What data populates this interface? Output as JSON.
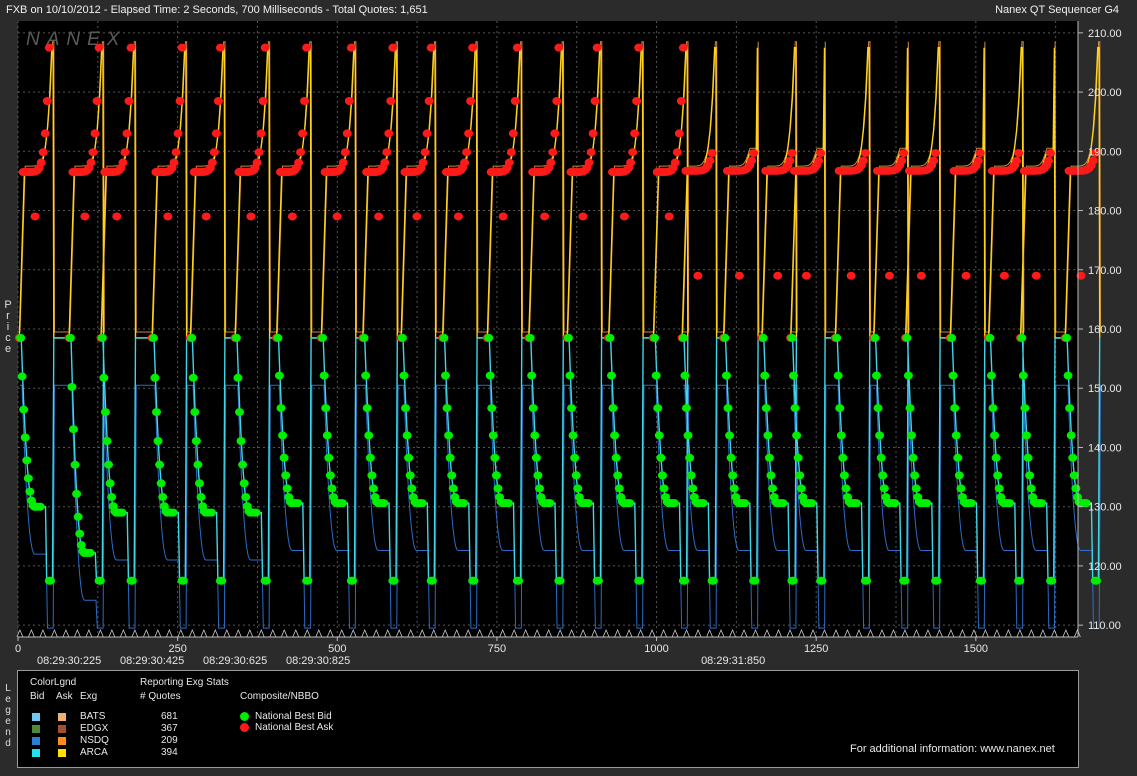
{
  "header": {
    "left": "FXB on 10/10/2012  -  Elapsed Time: 2 Seconds, 700 Milliseconds  -  Total Quotes: 1,651",
    "right": "Nanex QT Sequencer G4",
    "watermark": "NANEX"
  },
  "side_labels": {
    "y_axis": "Price",
    "legend": "Legend"
  },
  "chart_data": {
    "type": "line",
    "xlim": [
      0,
      1660
    ],
    "ylim": [
      108,
      212
    ],
    "y_ticks": [
      "210.00",
      "200.00",
      "190.00",
      "180.00",
      "170.00",
      "160.00",
      "150.00",
      "140.00",
      "130.00",
      "120.00",
      "110.00"
    ],
    "y_tick_values": [
      210,
      200,
      190,
      180,
      170,
      160,
      150,
      140,
      130,
      120,
      110
    ],
    "x_ticks": [
      "0",
      "250",
      "500",
      "750",
      "1000",
      "1250",
      "1500"
    ],
    "x_tick_values": [
      0,
      250,
      500,
      750,
      1000,
      1250,
      1500
    ],
    "time_labels": [
      {
        "x": 80,
        "label": "08:29:30:225"
      },
      {
        "x": 210,
        "label": "08:29:30:425"
      },
      {
        "x": 340,
        "label": "08:29:30:625"
      },
      {
        "x": 470,
        "label": "08:29:30:825"
      },
      {
        "x": 1120,
        "label": "08:29:31:850"
      }
    ],
    "grid": true,
    "cycle_starts": [
      2,
      80,
      130,
      210,
      270,
      340,
      405,
      475,
      540,
      600,
      665,
      735,
      800,
      860,
      925,
      995,
      1040,
      1105,
      1165,
      1210,
      1280,
      1340,
      1390,
      1460,
      1520,
      1570,
      1640
    ],
    "cycle_period": 55,
    "ask_range": [
      158.5,
      207.5
    ],
    "bid_range": [
      117.5,
      158.5
    ],
    "bid_plateaus": [
      130.0,
      122.2,
      129.0,
      130.6
    ],
    "series": [
      {
        "name": "National Best Bid",
        "color": "#00ee00"
      },
      {
        "name": "National Best Ask",
        "color": "#ff1a1a"
      }
    ],
    "line_colors": {
      "ask_primary": "#ffd21e",
      "ask_secondary": "#f5a03c",
      "bid_primary": "#3fd6e8",
      "bid_secondary": "#2f78d8"
    }
  },
  "legend": {
    "title": "ColorLgnd",
    "col_bid": "Bid",
    "col_ask": "Ask",
    "col_exg": "Exg",
    "stats_title": "Reporting Exg Stats",
    "stats_col": "# Quotes",
    "composite_title": "Composite/NBBO",
    "exchanges": [
      {
        "name": "BATS",
        "quotes": "681",
        "bid_color": "#6fc8f0",
        "ask_color": "#f0b070"
      },
      {
        "name": "EDGX",
        "quotes": "367",
        "bid_color": "#4f8a38",
        "ask_color": "#a0522d"
      },
      {
        "name": "NSDQ",
        "quotes": "209",
        "bid_color": "#2a7fd4",
        "ask_color": "#ff8c1a"
      },
      {
        "name": "ARCA",
        "quotes": "394",
        "bid_color": "#22e0f0",
        "ask_color": "#ffe000"
      }
    ],
    "composite": [
      {
        "name": "National Best Bid",
        "color": "#00ee00"
      },
      {
        "name": "National Best Ask",
        "color": "#ff1a1a"
      }
    ],
    "footer": "For additional information: www.nanex.net"
  }
}
